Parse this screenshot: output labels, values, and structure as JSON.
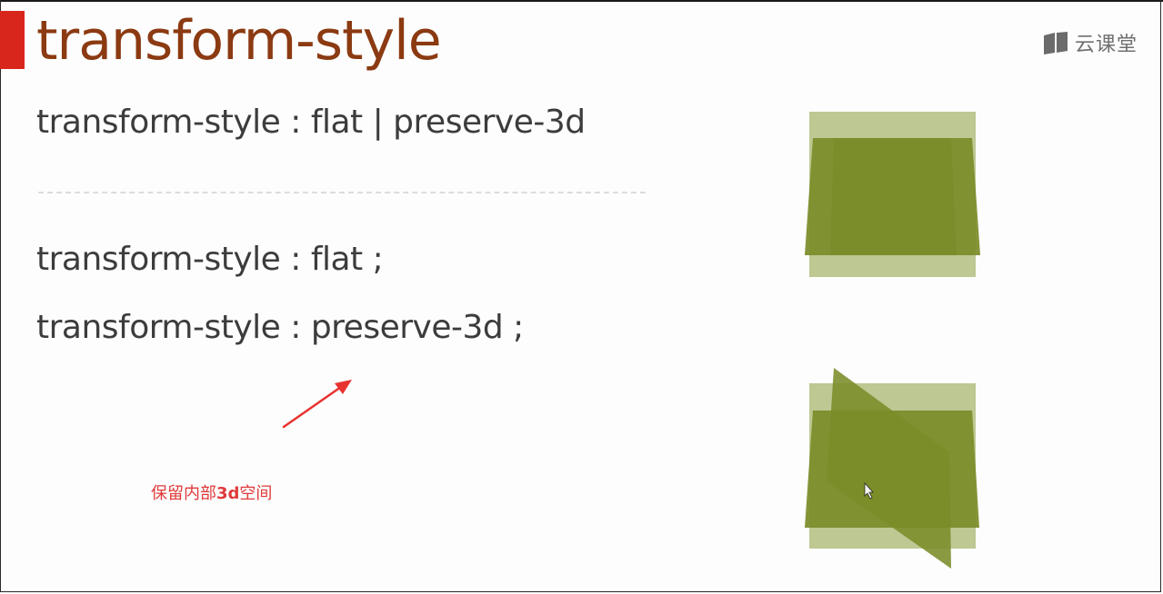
{
  "slide": {
    "title": "transform-style",
    "brand": "云课堂",
    "syntax": "transform-style : flat | preserve-3d",
    "example_flat": "transform-style : flat ;",
    "example_preserve": "transform-style : preserve-3d ;",
    "annotation": {
      "prefix": "保留内部",
      "emphasis": "3d",
      "suffix": "空间"
    }
  },
  "colors": {
    "title": "#8b3a12",
    "accent_bar": "#d9261c",
    "annotation": "#e03a3a",
    "demo_back": "#b9c58d",
    "demo_front": "#7a8c28"
  },
  "icons": {
    "brand": "book-icon",
    "arrow": "arrow-pointer-icon",
    "cursor": "mouse-cursor-icon"
  }
}
